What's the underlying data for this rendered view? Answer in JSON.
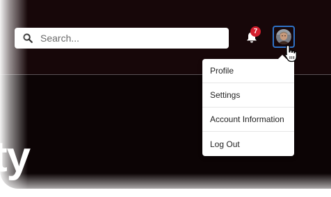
{
  "search": {
    "placeholder": "Search..."
  },
  "notifications": {
    "count": "7",
    "badge_color": "#d41f2e"
  },
  "avatar": {
    "border_color": "#2f73c9"
  },
  "user_menu": {
    "items": [
      {
        "label": "Profile"
      },
      {
        "label": "Settings"
      },
      {
        "label": "Account Information"
      },
      {
        "label": "Log Out"
      }
    ]
  },
  "hero": {
    "text_fragment": "ty"
  },
  "icons": {
    "search": "search-icon",
    "bell": "bell-icon",
    "cursor": "hand-pointer-icon"
  },
  "theme": {
    "header_bg": "#170709",
    "body_bg": "#0c0405"
  }
}
